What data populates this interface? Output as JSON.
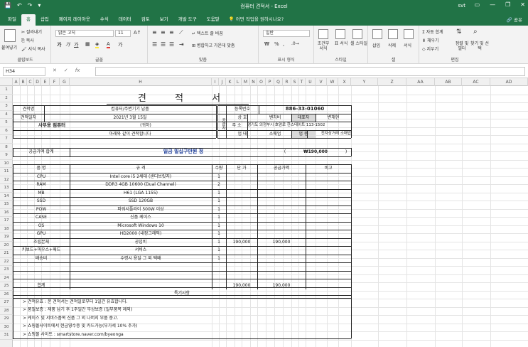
{
  "titlebar": {
    "title": "컴퓨터 견적서  -  Excel",
    "user": "svt",
    "qat": [
      "💾",
      "↶",
      "↷",
      "▾"
    ],
    "controls": [
      "▭",
      "—",
      "❐",
      "✕"
    ]
  },
  "tabs": [
    "파일",
    "홈",
    "삽입",
    "페이지 레이아웃",
    "수식",
    "데이터",
    "검토",
    "보기",
    "개발 도구",
    "도움말"
  ],
  "tellme": "💡 어떤 작업을 원하시나요?",
  "share": "🔗 공유",
  "ribbon": {
    "clipboard": {
      "label": "클립보드",
      "paste": "붙여넣기",
      "cut": "잘라내기",
      "copy": "복사",
      "format": "서식 복사"
    },
    "font": {
      "label": "글꼴",
      "name": "맑은 고딕",
      "size": "11",
      "bold": "가",
      "italic": "가",
      "underline": "가"
    },
    "align": {
      "label": "맞춤",
      "wrap": "텍스트 줄 바꿈",
      "merge": "병합하고 가운데 맞춤"
    },
    "number": {
      "label": "표시 형식",
      "format": "일반",
      "pct": "%",
      "comma": ","
    },
    "styles": {
      "label": "스타일",
      "cond": "조건부 서식",
      "table": "표 서식",
      "cell": "셀 스타일"
    },
    "cells": {
      "label": "셀",
      "insert": "삽입",
      "delete": "삭제",
      "format": "서식"
    },
    "edit": {
      "label": "편집",
      "autosum": "Σ 자동 합계",
      "fill": "채우기",
      "clear": "지우기",
      "sort": "정렬 및 필터",
      "find": "찾기 및 선택"
    }
  },
  "formula": {
    "namebox": "H34",
    "cancel": "✕",
    "enter": "✓",
    "fx": "fx",
    "value": ""
  },
  "columns": [
    "A",
    "B",
    "C",
    "D",
    "E",
    "F",
    "G",
    "H",
    "I",
    "J",
    "K",
    "L",
    "M",
    "N",
    "O",
    "P",
    "Q",
    "R",
    "S",
    "T",
    "U",
    "V",
    "W",
    "X",
    "Y",
    "Z",
    "AA",
    "AB",
    "AC",
    "AD"
  ],
  "rows": [
    "1",
    "2",
    "3",
    "4",
    "5",
    "6",
    "7",
    "8",
    "9",
    "10",
    "11",
    "12",
    "13",
    "14",
    "15",
    "16",
    "17",
    "18",
    "19",
    "20",
    "21",
    "22",
    "23",
    "24",
    "25",
    "26",
    "27",
    "28",
    "29",
    "30",
    "31"
  ],
  "sheet": {
    "title": "견 적 서",
    "header_left": [
      {
        "label": "견적명",
        "value": "컴퓨터/주변기기 납품"
      },
      {
        "label": "견적일자",
        "value": "2021년 3월 15일"
      },
      {
        "label": "사무용 컴퓨터",
        "value": "(귀하)"
      }
    ],
    "intro": "아래와 같이 견적합니다",
    "supplier_tag": "공급자",
    "supplier": {
      "reg_label": "등록번호",
      "reg": "886-33-01060",
      "name_label": "상 호",
      "name": "벤처비",
      "ceo_label": "대표자",
      "ceo": "변채현",
      "addr_label": "주 소",
      "addr": "경기도 의정부시 호암로 한스테이트 113-1502",
      "type_label": "업 태",
      "type": "소매업",
      "item_label": "업 종",
      "item": "전자상거래 소매업"
    },
    "total_label": "공급가액 합계",
    "total_words": "일금 일십구만원 정",
    "total_paren_open": "(",
    "total_amount": "₩190,000",
    "total_paren_close": ")",
    "table_headers": [
      "품   명",
      "규 격",
      "수량",
      "단 가",
      "공급가액",
      "비고"
    ],
    "items": [
      {
        "name": "CPU",
        "spec": "Intel core i5 2세대 (샌디브릿지)",
        "qty": "1",
        "price": "",
        "amount": ""
      },
      {
        "name": "RAM",
        "spec": "DDR3 4GB 10600 (Dual Channel)",
        "qty": "2",
        "price": "",
        "amount": ""
      },
      {
        "name": "MB",
        "spec": "H61 (LGA 1155)",
        "qty": "1",
        "price": "",
        "amount": ""
      },
      {
        "name": "SSD",
        "spec": "SSD 120GB",
        "qty": "1",
        "price": "",
        "amount": ""
      },
      {
        "name": "POW",
        "spec": "파워서플라이 500W 이상",
        "qty": "1",
        "price": "",
        "amount": ""
      },
      {
        "name": "CASE",
        "spec": "신품 케이스",
        "qty": "1",
        "price": "",
        "amount": ""
      },
      {
        "name": "OS",
        "spec": "Microsoft Windows 10",
        "qty": "1",
        "price": "",
        "amount": ""
      },
      {
        "name": "GPU",
        "spec": "HD2000 (내장그래픽)",
        "qty": "1",
        "price": "",
        "amount": ""
      },
      {
        "name": "조립본체",
        "spec": "공임비",
        "qty": "1",
        "price": "190,000",
        "amount": "190,000"
      },
      {
        "name": "키보드+마우스+패드",
        "spec": "서비스",
        "qty": "1",
        "price": "",
        "amount": ""
      },
      {
        "name": "배송비",
        "spec": "수령시 용달 그 외 택배",
        "qty": "1",
        "price": "",
        "amount": ""
      },
      {
        "name": "",
        "spec": "",
        "qty": "",
        "price": "",
        "amount": ""
      },
      {
        "name": "",
        "spec": "",
        "qty": "",
        "price": "",
        "amount": ""
      }
    ],
    "sum_label": "합계",
    "sum_price": "190,000",
    "sum_amount": "190,000",
    "notes_title": "특기사항",
    "notes": [
      ">   견적유효 : 본 견적서는 견적일로부터 1일간 유효합니다.",
      ">   품질보증 : 제품 납기 후 1주일간 무상보증 (일부품목 제외)",
      ">   케이스 및 서비스품목 신품 그 외 나머지 부품 중고.",
      ">   쇼핑몰사이트에서 현금영수증 및 카드가능(부가세 10% 추가)",
      ">   쇼핑몰 사이트 : smartstore.naver.com/byeonga"
    ]
  }
}
